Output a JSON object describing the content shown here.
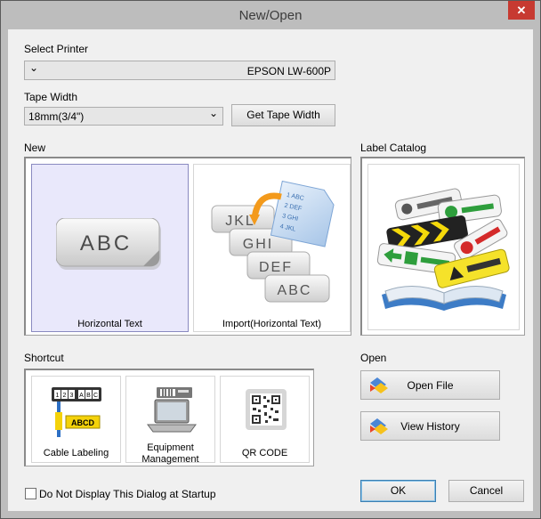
{
  "window": {
    "title": "New/Open",
    "close_glyph": "✕"
  },
  "printer": {
    "label": "Select Printer",
    "value": "EPSON LW-600P",
    "arrow": "⌄"
  },
  "tape": {
    "label": "Tape Width",
    "value": "18mm(3/4\")",
    "arrow": "⌄",
    "button": "Get Tape Width"
  },
  "new_section": {
    "label": "New",
    "tiles": [
      {
        "caption": "Horizontal Text",
        "image_text": "ABC"
      },
      {
        "caption": "Import(Horizontal Text)",
        "labels": [
          "JKL",
          "GHI",
          "DEF",
          "ABC"
        ],
        "doc_lines": [
          "1 ABC",
          "2 DEF",
          "3 GHI",
          "4 JKL"
        ]
      }
    ]
  },
  "catalog": {
    "label": "Label Catalog"
  },
  "shortcut": {
    "label": "Shortcut",
    "tiles": [
      {
        "caption": "Cable Labeling",
        "image_text": [
          "1",
          "2",
          "3",
          "A",
          "B",
          "C",
          "ABCD"
        ]
      },
      {
        "caption_line1": "Equipment",
        "caption_line2": "Management"
      },
      {
        "caption": "QR CODE"
      }
    ]
  },
  "open_section": {
    "label": "Open",
    "open_file": "Open File",
    "view_history": "View History"
  },
  "footer": {
    "checkbox_label": "Do Not Display This Dialog at Startup",
    "ok": "OK",
    "cancel": "Cancel"
  },
  "colors": {
    "accent": "#3c7fb1",
    "close": "#c73a31",
    "selected_tile": "#e9e8fb"
  }
}
